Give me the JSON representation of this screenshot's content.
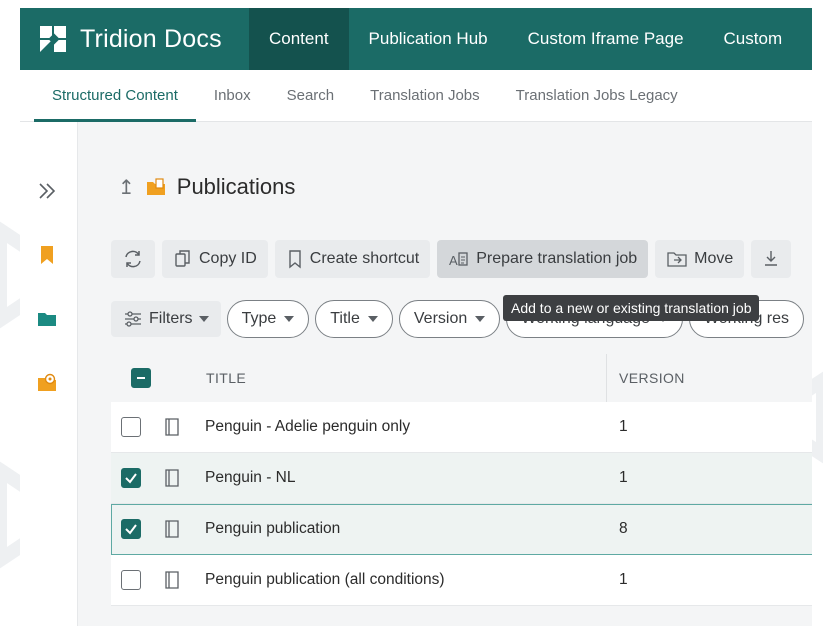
{
  "brand": {
    "name": "Tridion Docs"
  },
  "topnav": [
    {
      "label": "Content",
      "active": true
    },
    {
      "label": "Publication Hub"
    },
    {
      "label": "Custom Iframe Page"
    },
    {
      "label": "Custom"
    }
  ],
  "tabs": [
    {
      "label": "Structured Content",
      "active": true
    },
    {
      "label": "Inbox"
    },
    {
      "label": "Search"
    },
    {
      "label": "Translation Jobs"
    },
    {
      "label": "Translation Jobs Legacy"
    }
  ],
  "rail": [
    "expand-icon",
    "bookmark-icon",
    "folder-icon",
    "gear-folder-icon"
  ],
  "breadcrumb": {
    "title": "Publications"
  },
  "toolbar": {
    "copy_id": "Copy ID",
    "create_shortcut": "Create shortcut",
    "prepare_translation": "Prepare translation job",
    "move": "Move"
  },
  "tooltip": "Add to a new or existing translation job",
  "filters": {
    "label": "Filters",
    "chips": [
      "Type",
      "Title",
      "Version",
      "Working language",
      "Working res"
    ]
  },
  "table": {
    "headers": {
      "title": "TITLE",
      "version": "VERSION"
    },
    "rows": [
      {
        "title": "Penguin - Adelie penguin only",
        "version": "1",
        "checked": false
      },
      {
        "title": "Penguin - NL",
        "version": "1",
        "checked": true
      },
      {
        "title": "Penguin publication",
        "version": "8",
        "checked": true
      },
      {
        "title": "Penguin publication (all conditions)",
        "version": "1",
        "checked": false
      }
    ]
  },
  "colors": {
    "brand": "#1b6b66",
    "brand_dark": "#14524e"
  }
}
